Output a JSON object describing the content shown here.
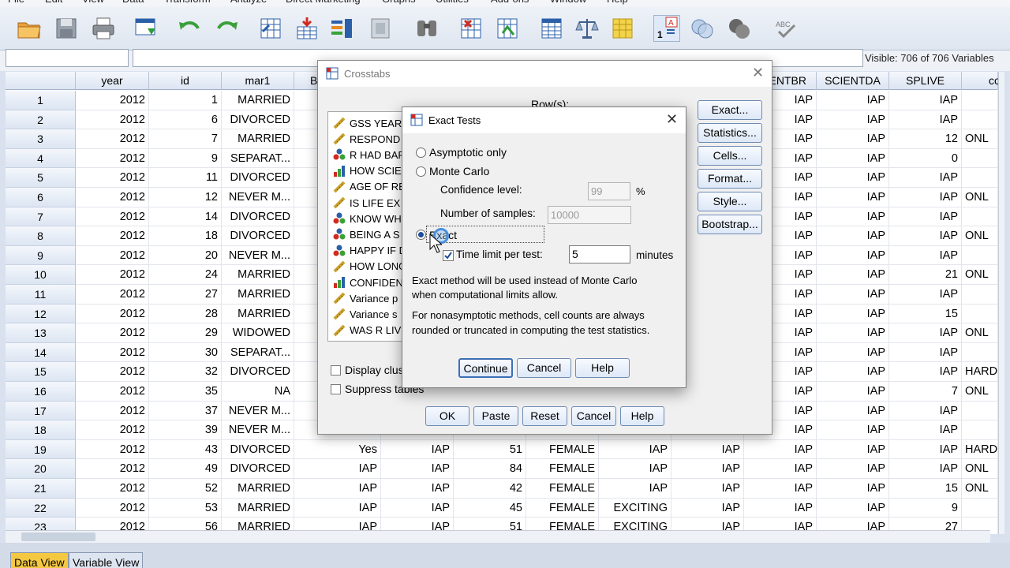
{
  "menu": [
    "File",
    "Edit",
    "View",
    "Data",
    "Transform",
    "Analyze",
    "Direct Marketing",
    "Graphs",
    "Utilities",
    "Add-ons",
    "Window",
    "Help"
  ],
  "status": {
    "visible": "Visible: 706 of 706 Variables"
  },
  "columns": [
    "year",
    "id",
    "mar1",
    "B",
    "",
    "",
    "",
    "",
    "",
    "ENTBR",
    "SCIENTDA",
    "SPLIVE",
    "co"
  ],
  "rows": [
    {
      "n": "1",
      "year": "2012",
      "id": "1",
      "mar1": "MARRIED",
      "entbr": "IAP",
      "scientda": "IAP",
      "splive": "IAP",
      "co": ""
    },
    {
      "n": "2",
      "year": "2012",
      "id": "6",
      "mar1": "DIVORCED",
      "entbr": "IAP",
      "scientda": "IAP",
      "splive": "IAP",
      "co": ""
    },
    {
      "n": "3",
      "year": "2012",
      "id": "7",
      "mar1": "MARRIED",
      "entbr": "IAP",
      "scientda": "IAP",
      "splive": "12",
      "co": "ONL"
    },
    {
      "n": "4",
      "year": "2012",
      "id": "9",
      "mar1": "SEPARAT...",
      "entbr": "IAP",
      "scientda": "IAP",
      "splive": "0",
      "co": ""
    },
    {
      "n": "5",
      "year": "2012",
      "id": "11",
      "mar1": "DIVORCED",
      "entbr": "IAP",
      "scientda": "IAP",
      "splive": "IAP",
      "co": ""
    },
    {
      "n": "6",
      "year": "2012",
      "id": "12",
      "mar1": "NEVER M...",
      "entbr": "IAP",
      "scientda": "IAP",
      "splive": "IAP",
      "co": "ONL"
    },
    {
      "n": "7",
      "year": "2012",
      "id": "14",
      "mar1": "DIVORCED",
      "entbr": "IAP",
      "scientda": "IAP",
      "splive": "IAP",
      "co": ""
    },
    {
      "n": "8",
      "year": "2012",
      "id": "18",
      "mar1": "DIVORCED",
      "entbr": "IAP",
      "scientda": "IAP",
      "splive": "IAP",
      "co": "ONL"
    },
    {
      "n": "9",
      "year": "2012",
      "id": "20",
      "mar1": "NEVER M...",
      "entbr": "IAP",
      "scientda": "IAP",
      "splive": "IAP",
      "co": ""
    },
    {
      "n": "10",
      "year": "2012",
      "id": "24",
      "mar1": "MARRIED",
      "entbr": "IAP",
      "scientda": "IAP",
      "splive": "21",
      "co": "ONL"
    },
    {
      "n": "11",
      "year": "2012",
      "id": "27",
      "mar1": "MARRIED",
      "entbr": "IAP",
      "scientda": "IAP",
      "splive": "IAP",
      "co": ""
    },
    {
      "n": "12",
      "year": "2012",
      "id": "28",
      "mar1": "MARRIED",
      "entbr": "IAP",
      "scientda": "IAP",
      "splive": "15",
      "co": ""
    },
    {
      "n": "13",
      "year": "2012",
      "id": "29",
      "mar1": "WIDOWED",
      "entbr": "IAP",
      "scientda": "IAP",
      "splive": "IAP",
      "co": "ONL"
    },
    {
      "n": "14",
      "year": "2012",
      "id": "30",
      "mar1": "SEPARAT...",
      "entbr": "IAP",
      "scientda": "IAP",
      "splive": "IAP",
      "co": ""
    },
    {
      "n": "15",
      "year": "2012",
      "id": "32",
      "mar1": "DIVORCED",
      "entbr": "IAP",
      "scientda": "IAP",
      "splive": "IAP",
      "co": "HARD"
    },
    {
      "n": "16",
      "year": "2012",
      "id": "35",
      "mar1": "NA",
      "entbr": "IAP",
      "scientda": "IAP",
      "splive": "7",
      "co": "ONL"
    },
    {
      "n": "17",
      "year": "2012",
      "id": "37",
      "mar1": "NEVER M...",
      "entbr": "IAP",
      "scientda": "IAP",
      "splive": "IAP",
      "co": ""
    },
    {
      "n": "18",
      "year": "2012",
      "id": "39",
      "mar1": "NEVER M...",
      "entbr": "IAP",
      "scientda": "IAP",
      "splive": "IAP",
      "co": ""
    },
    {
      "n": "19",
      "year": "2012",
      "id": "43",
      "mar1": "DIVORCED",
      "b": "Yes",
      "c5": "IAP",
      "c6": "51",
      "c7": "FEMALE",
      "c8": "IAP",
      "c9": "IAP",
      "entbr": "IAP",
      "scientda": "IAP",
      "splive": "IAP",
      "co": "HARD"
    },
    {
      "n": "20",
      "year": "2012",
      "id": "49",
      "mar1": "DIVORCED",
      "b": "IAP",
      "c5": "IAP",
      "c6": "84",
      "c7": "FEMALE",
      "c8": "IAP",
      "c9": "IAP",
      "entbr": "IAP",
      "scientda": "IAP",
      "splive": "IAP",
      "co": "ONL"
    },
    {
      "n": "21",
      "year": "2012",
      "id": "52",
      "mar1": "MARRIED",
      "b": "IAP",
      "c5": "IAP",
      "c6": "42",
      "c7": "FEMALE",
      "c8": "IAP",
      "c9": "IAP",
      "entbr": "IAP",
      "scientda": "IAP",
      "splive": "15",
      "co": "ONL"
    },
    {
      "n": "22",
      "year": "2012",
      "id": "53",
      "mar1": "MARRIED",
      "b": "IAP",
      "c5": "IAP",
      "c6": "45",
      "c7": "FEMALE",
      "c8": "EXCITING",
      "c9": "IAP",
      "entbr": "IAP",
      "scientda": "IAP",
      "splive": "9",
      "co": ""
    },
    {
      "n": "23",
      "year": "2012",
      "id": "56",
      "mar1": "MARRIED",
      "b": "IAP",
      "c5": "IAP",
      "c6": "51",
      "c7": "FEMALE",
      "c8": "EXCITING",
      "c9": "IAP",
      "entbr": "IAP",
      "scientda": "IAP",
      "splive": "27",
      "co": ""
    }
  ],
  "tabs": {
    "data_view": "Data View",
    "variable_view": "Variable View"
  },
  "crosstabs": {
    "title": "Crosstabs",
    "rows_label": "Row(s):",
    "variables": [
      {
        "icon": "ruler",
        "label": "GSS YEAR"
      },
      {
        "icon": "ruler",
        "label": "RESPOND"
      },
      {
        "icon": "nominal",
        "label": "R HAD BAF"
      },
      {
        "icon": "bar",
        "label": "HOW SCIE"
      },
      {
        "icon": "ruler",
        "label": "AGE OF RE"
      },
      {
        "icon": "ruler",
        "label": "IS LIFE EX"
      },
      {
        "icon": "nominal",
        "label": "KNOW WH"
      },
      {
        "icon": "nominal",
        "label": "BEING A S"
      },
      {
        "icon": "nominal",
        "label": "HAPPY IF D"
      },
      {
        "icon": "ruler",
        "label": "HOW LONG"
      },
      {
        "icon": "bar",
        "label": "CONFIDEN"
      },
      {
        "icon": "ruler",
        "label": "Variance p"
      },
      {
        "icon": "ruler",
        "label": "Variance s"
      },
      {
        "icon": "ruler",
        "label": "WAS R LIV"
      }
    ],
    "side_buttons": [
      "Exact...",
      "Statistics...",
      "Cells...",
      "Format...",
      "Style...",
      "Bootstrap..."
    ],
    "display_clustered": "Display clus",
    "suppress_tables": "Suppress tables",
    "buttons": {
      "ok": "OK",
      "paste": "Paste",
      "reset": "Reset",
      "cancel": "Cancel",
      "help": "Help"
    }
  },
  "exact_tests": {
    "title": "Exact Tests",
    "asymptotic": "Asymptotic only",
    "monte_carlo": "Monte Carlo",
    "confidence_label": "Confidence level:",
    "confidence_value": "99",
    "percent": "%",
    "samples_label": "Number of samples:",
    "samples_value": "10000",
    "exact": "Exact",
    "time_limit_label": "Time limit per test:",
    "time_limit_value": "5",
    "minutes": "minutes",
    "note1_line1": "Exact method will be used instead of Monte Carlo",
    "note1_line2": "when computational limits allow.",
    "note2_line1": "For nonasymptotic methods, cell counts are always",
    "note2_line2": "rounded or truncated in computing the test statistics.",
    "continue": "Continue",
    "cancel": "Cancel",
    "help": "Help",
    "selected": "exact",
    "time_limit_checked": true
  },
  "colors": {
    "accent": "#3d6fb5",
    "header_bg": "#dce5f2",
    "selected_tab": "#f5c842"
  }
}
